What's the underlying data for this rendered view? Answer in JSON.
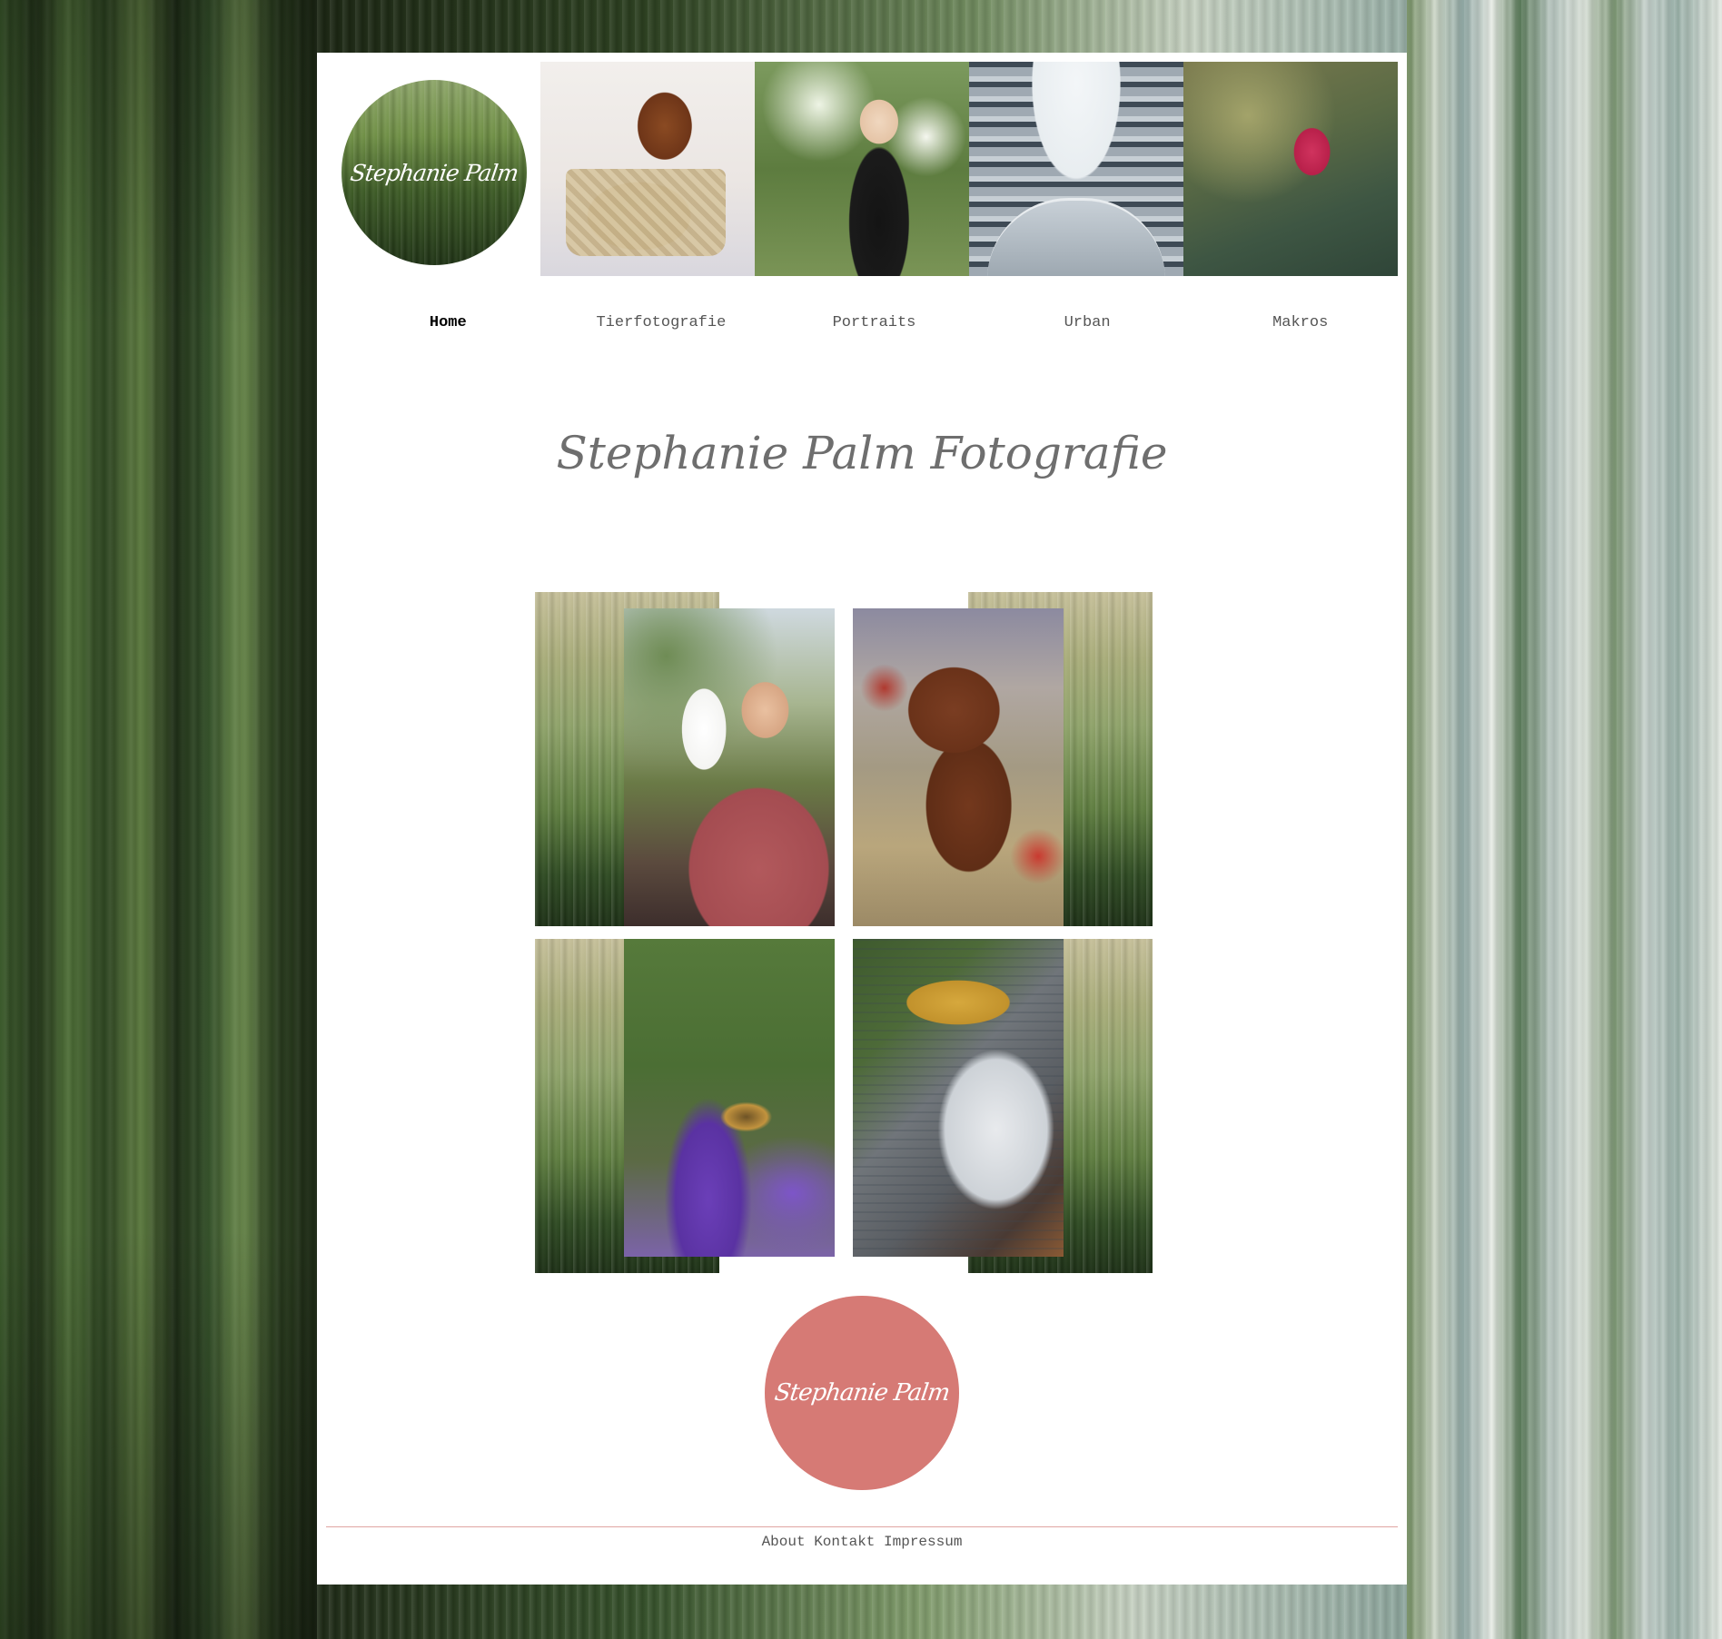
{
  "logo": {
    "signature": "Stephanie Palm"
  },
  "header_photos": [
    {
      "subject": "dachshund puppy in basket",
      "category": "Tierfotografie"
    },
    {
      "subject": "woman holding pug",
      "category": "Portraits"
    },
    {
      "subject": "building facade upward view",
      "category": "Urban"
    },
    {
      "subject": "red poppy macro",
      "category": "Makros"
    }
  ],
  "nav": {
    "items": [
      {
        "label": "Home",
        "active": true
      },
      {
        "label": "Tierfotografie",
        "active": false
      },
      {
        "label": "Portraits",
        "active": false
      },
      {
        "label": "Urban",
        "active": false
      },
      {
        "label": "Makros",
        "active": false
      }
    ]
  },
  "main": {
    "title": "Stephanie Palm Fotografie"
  },
  "gallery": [
    {
      "subject": "man with cockatoo"
    },
    {
      "subject": "running dachshund with autumn leaves"
    },
    {
      "subject": "bee on lavender"
    },
    {
      "subject": "city aerial view"
    }
  ],
  "footer": {
    "signature": "Stephanie Palm",
    "links": [
      "About",
      "Kontakt",
      "Impressum"
    ]
  },
  "colors": {
    "page_background": "#ffffff",
    "accent_pink": "#d67a75",
    "footer_rule": "#e0a5a2",
    "nav_text": "#555555",
    "nav_active": "#000000",
    "title_text": "#6e6e6e"
  }
}
